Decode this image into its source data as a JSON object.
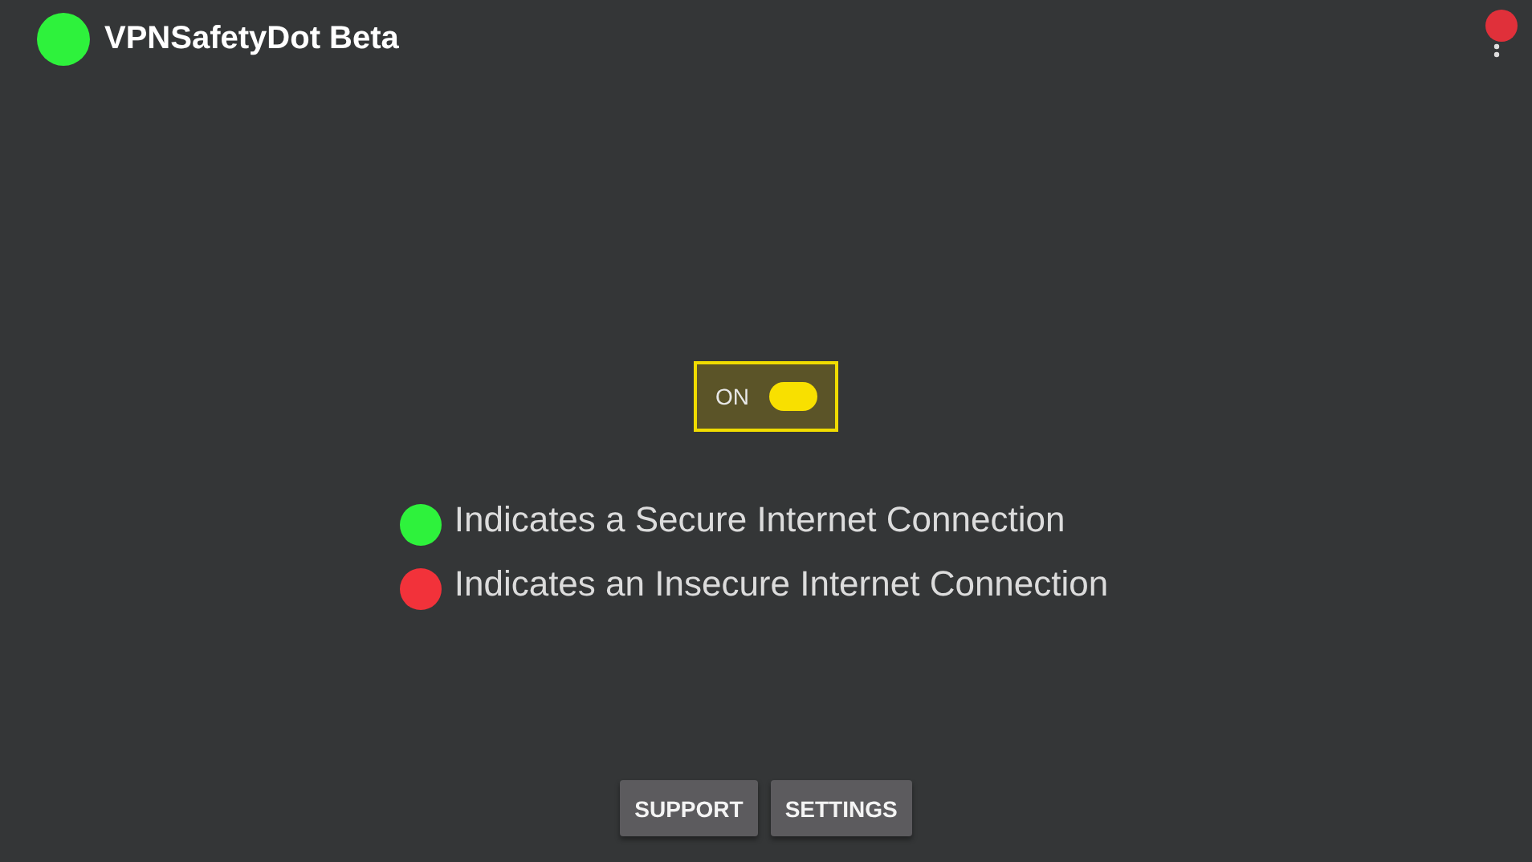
{
  "app_bar": {
    "title": "VPNSafetyDot Beta",
    "status_dot": {
      "color": "#2ef23c"
    },
    "overlay_dot": {
      "color": "#e0303a"
    }
  },
  "toggle": {
    "label": "ON",
    "on": true
  },
  "legend": [
    {
      "color": "#2ef23c",
      "text": "Indicates a Secure Internet Connection"
    },
    {
      "color": "#f2323a",
      "text": "Indicates an Insecure Internet Connection"
    }
  ],
  "buttons": [
    "SUPPORT",
    "SETTINGS"
  ]
}
